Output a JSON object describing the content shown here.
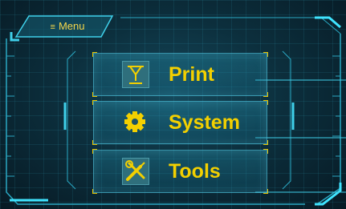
{
  "header": {
    "menu_label": "Menu",
    "menu_icon": "hamburger-icon"
  },
  "menu": {
    "items": [
      {
        "label": "Print",
        "icon": "printer-nozzle-icon"
      },
      {
        "label": "System",
        "icon": "gear-icon"
      },
      {
        "label": "Tools",
        "icon": "tools-icon"
      }
    ]
  },
  "colors": {
    "accent": "#f3d000",
    "frame": "#3fd0ea",
    "background": "#0c2f3d"
  }
}
